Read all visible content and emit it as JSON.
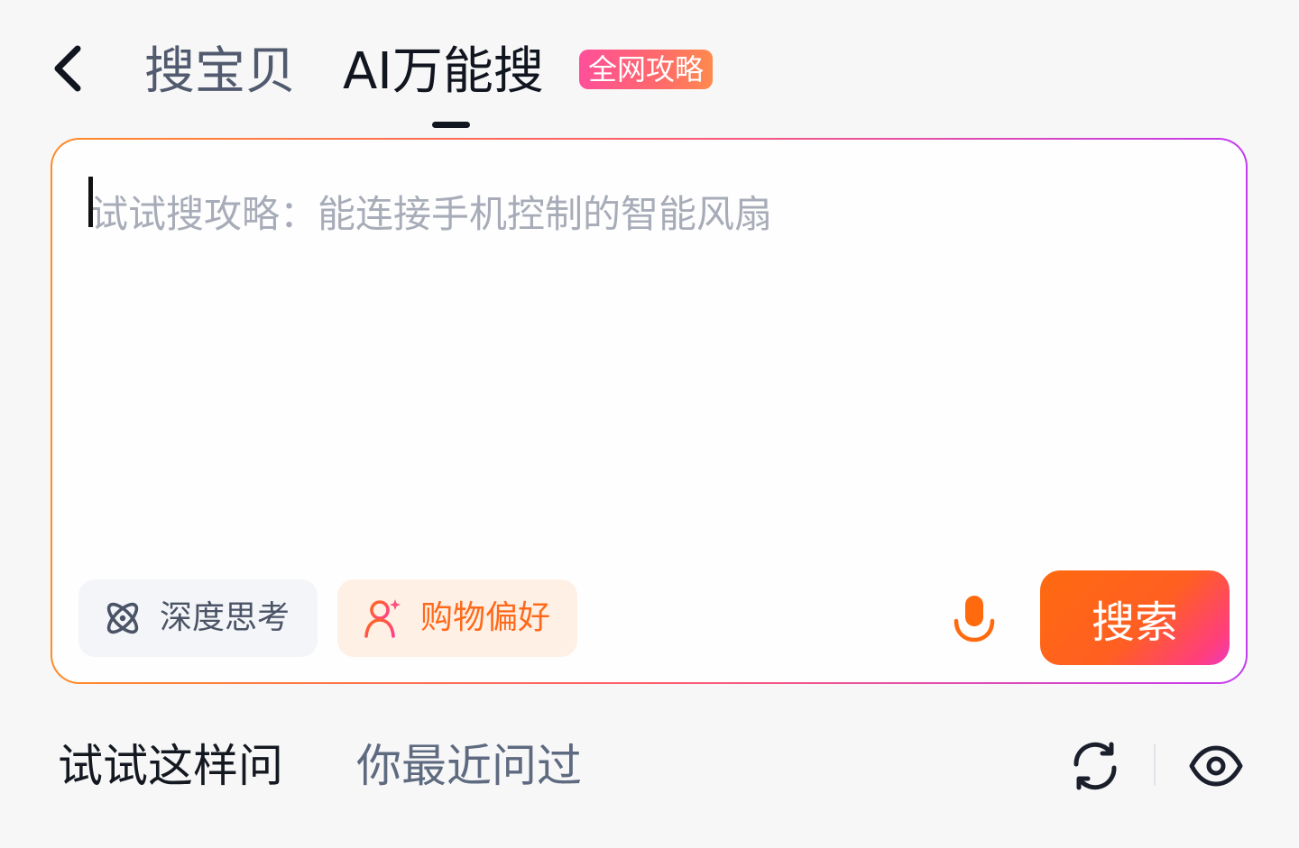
{
  "header": {
    "back_icon": "chevron-left-icon",
    "tabs": [
      {
        "label": "搜宝贝",
        "active": false
      },
      {
        "label": "AI万能搜",
        "active": true
      }
    ],
    "badge": "全网攻略"
  },
  "search": {
    "placeholder": "试试搜攻略：能连接手机控制的智能风扇",
    "value": "",
    "chips": [
      {
        "label": "深度思考",
        "icon": "atom-icon"
      },
      {
        "label": "购物偏好",
        "icon": "user-sparkle-icon"
      }
    ],
    "mic_icon": "microphone-icon",
    "submit_label": "搜索"
  },
  "suggestions": {
    "tabs": [
      {
        "label": "试试这样问",
        "active": true
      },
      {
        "label": "你最近问过",
        "active": false
      }
    ],
    "refresh_icon": "refresh-icon",
    "visibility_icon": "eye-icon"
  },
  "colors": {
    "accent_orange": "#ff6a0f",
    "accent_pink": "#ff3d7f",
    "accent_purple": "#c33cf0",
    "text_primary": "#11151f",
    "placeholder": "#a7acb8"
  }
}
